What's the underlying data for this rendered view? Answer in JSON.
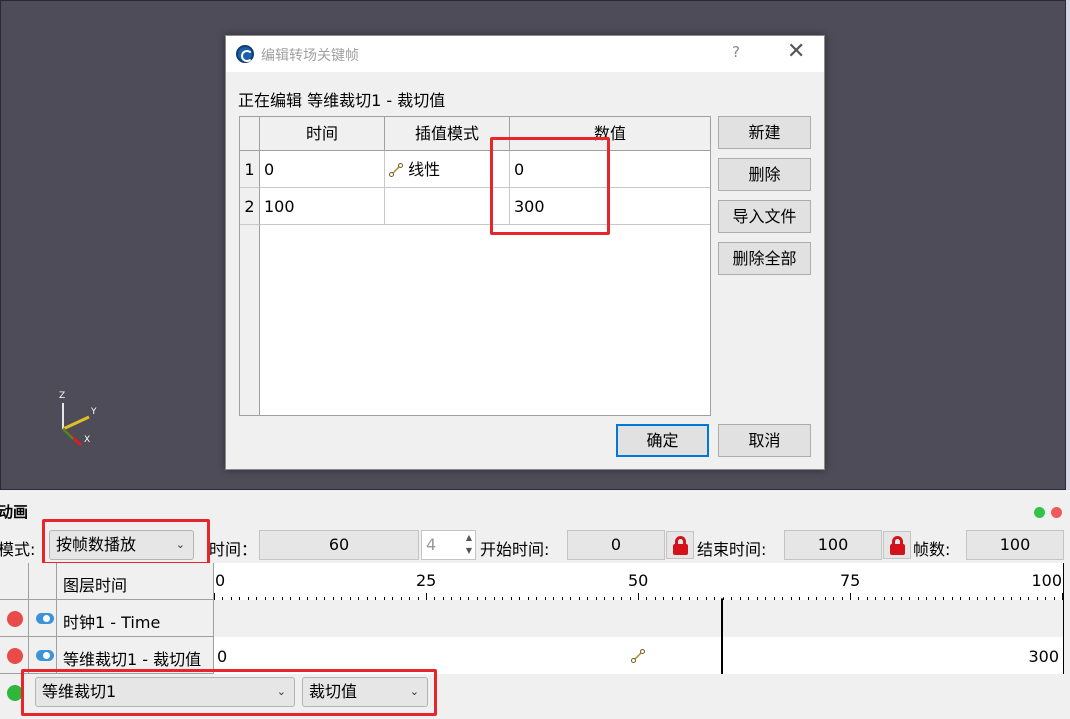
{
  "dialog": {
    "title": "编辑转场关键帧",
    "help": "?",
    "close": "✕",
    "editing_label": "正在编辑 等维裁切1 - 裁切值",
    "columns": [
      "时间",
      "插值模式",
      "数值"
    ],
    "rows": [
      {
        "index": "1",
        "time": "0",
        "interp": "线性",
        "value": "0"
      },
      {
        "index": "2",
        "time": "100",
        "interp": "",
        "value": "300"
      }
    ],
    "buttons": {
      "new": "新建",
      "delete": "删除",
      "import": "导入文件",
      "delete_all": "删除全部"
    },
    "ok": "确定",
    "cancel": "取消"
  },
  "viewport": {
    "axis_labels": {
      "z": "Z",
      "y": "Y",
      "x": "X"
    }
  },
  "anim": {
    "title": "动画",
    "mode_label": "模式:",
    "mode_value": "按帧数播放",
    "time_label": "时间：",
    "time_value": "60",
    "spin_value": "4",
    "start_label": "开始时间:",
    "start_value": "0",
    "end_label": "结束时间:",
    "end_value": "100",
    "frames_label": "帧数:",
    "frames_value": "100",
    "layer_time_label": "图层时间",
    "ruler": [
      "0",
      "25",
      "50",
      "75",
      "100"
    ],
    "tracks": [
      {
        "name": "时钟1 - Time",
        "start": "",
        "end": ""
      },
      {
        "name": "等维裁切1 - 裁切值",
        "start": "0",
        "end": "300"
      }
    ],
    "source_select": "等维裁切1",
    "property_select": "裁切值"
  },
  "colors": {
    "highlight_red": "#e6262b",
    "accent_blue": "#0078d7",
    "viewport_bg": "#4e4c59"
  }
}
